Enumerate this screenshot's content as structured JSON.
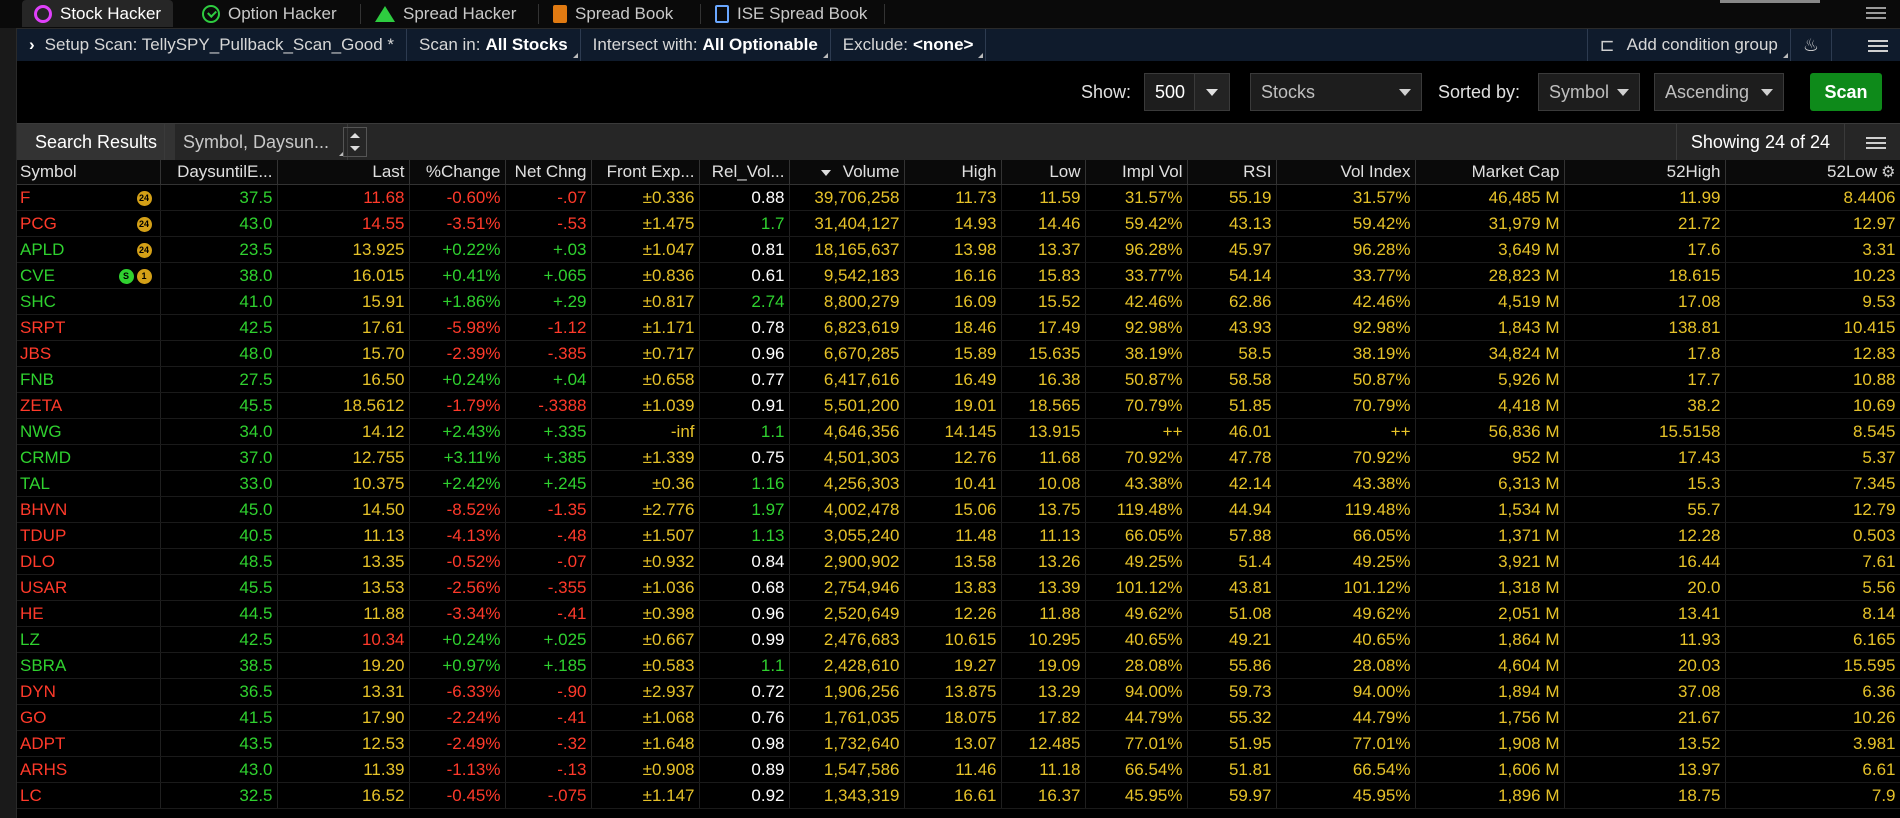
{
  "tabs": [
    {
      "label": "Stock Hacker",
      "icon": "stock-hacker-icon"
    },
    {
      "label": "Option Hacker",
      "icon": "option-hacker-icon"
    },
    {
      "label": "Spread Hacker",
      "icon": "spread-hacker-icon"
    },
    {
      "label": "Spread Book",
      "icon": "spread-book-icon"
    },
    {
      "label": "ISE Spread Book",
      "icon": "ise-spread-book-icon"
    }
  ],
  "setup": {
    "scan_label": "Setup Scan: TellySPY_Pullback_Scan_Good *",
    "scan_in_label": "Scan in:",
    "scan_in_value": "All Stocks",
    "intersect_label": "Intersect with:",
    "intersect_value": "All Optionable",
    "exclude_label": "Exclude:",
    "exclude_value": "<none>",
    "add_group": "Add condition group"
  },
  "controls": {
    "show_label": "Show:",
    "show_value": "500",
    "type_value": "Stocks",
    "sorted_label": "Sorted by:",
    "sort_field": "Symbol",
    "sort_order": "Ascending",
    "scan_button": "Scan"
  },
  "results": {
    "tab_label": "Search Results",
    "columns_label": "Symbol, Daysun...",
    "showing": "Showing 24 of 24"
  },
  "columns": [
    "Symbol",
    "DaysuntilE...",
    "Last",
    "%Change",
    "Net Chng",
    "Front Exp...",
    "Rel_Vol...",
    "Volume",
    "High",
    "Low",
    "Impl Vol",
    "RSI",
    "Vol Index",
    "Market Cap",
    "52High",
    "52Low"
  ],
  "rows": [
    {
      "sym": "F",
      "dir": "down",
      "rel": "w",
      "lastc": "r",
      "badges": [
        "24"
      ],
      "cells": [
        "37.5",
        "11.68",
        "-0.60%",
        "-.07",
        "±0.336",
        "0.88",
        "39,706,258",
        "11.73",
        "11.59",
        "31.57%",
        "55.19",
        "31.57%",
        "46,485 M",
        "11.99",
        "8.4406"
      ]
    },
    {
      "sym": "PCG",
      "dir": "down",
      "rel": "g",
      "lastc": "r",
      "badges": [
        "24"
      ],
      "cells": [
        "43.0",
        "14.55",
        "-3.51%",
        "-.53",
        "±1.475",
        "1.7",
        "31,404,127",
        "14.93",
        "14.46",
        "59.42%",
        "43.13",
        "59.42%",
        "31,979 M",
        "21.72",
        "12.97"
      ]
    },
    {
      "sym": "APLD",
      "dir": "up",
      "rel": "w",
      "lastc": "y",
      "badges": [
        "24"
      ],
      "cells": [
        "23.5",
        "13.925",
        "+0.22%",
        "+.03",
        "±1.047",
        "0.81",
        "18,165,637",
        "13.98",
        "13.37",
        "96.28%",
        "45.97",
        "96.28%",
        "3,649 M",
        "17.6",
        "3.31"
      ]
    },
    {
      "sym": "CVE",
      "dir": "up",
      "rel": "w",
      "lastc": "y",
      "badges": [
        "S",
        "1"
      ],
      "cells": [
        "38.0",
        "16.015",
        "+0.41%",
        "+.065",
        "±0.836",
        "0.61",
        "9,542,183",
        "16.16",
        "15.83",
        "33.77%",
        "54.14",
        "33.77%",
        "28,823 M",
        "18.615",
        "10.23"
      ]
    },
    {
      "sym": "SHC",
      "dir": "up",
      "rel": "g",
      "lastc": "y",
      "badges": [],
      "cells": [
        "41.0",
        "15.91",
        "+1.86%",
        "+.29",
        "±0.817",
        "2.74",
        "8,800,279",
        "16.09",
        "15.52",
        "42.46%",
        "62.86",
        "42.46%",
        "4,519 M",
        "17.08",
        "9.53"
      ]
    },
    {
      "sym": "SRPT",
      "dir": "down",
      "rel": "w",
      "lastc": "y",
      "badges": [],
      "cells": [
        "42.5",
        "17.61",
        "-5.98%",
        "-1.12",
        "±1.171",
        "0.78",
        "6,823,619",
        "18.46",
        "17.49",
        "92.98%",
        "43.93",
        "92.98%",
        "1,843 M",
        "138.81",
        "10.415"
      ]
    },
    {
      "sym": "JBS",
      "dir": "down",
      "rel": "w",
      "lastc": "y",
      "badges": [],
      "cells": [
        "48.0",
        "15.70",
        "-2.39%",
        "-.385",
        "±0.717",
        "0.96",
        "6,670,285",
        "15.89",
        "15.635",
        "38.19%",
        "58.5",
        "38.19%",
        "34,824 M",
        "17.8",
        "12.83"
      ]
    },
    {
      "sym": "FNB",
      "dir": "up",
      "rel": "w",
      "lastc": "y",
      "badges": [],
      "cells": [
        "27.5",
        "16.50",
        "+0.24%",
        "+.04",
        "±0.658",
        "0.77",
        "6,417,616",
        "16.49",
        "16.38",
        "50.87%",
        "58.58",
        "50.87%",
        "5,926 M",
        "17.7",
        "10.88"
      ]
    },
    {
      "sym": "ZETA",
      "dir": "down",
      "rel": "w",
      "lastc": "y",
      "badges": [],
      "cells": [
        "45.5",
        "18.5612",
        "-1.79%",
        "-.3388",
        "±1.039",
        "0.91",
        "5,501,200",
        "19.01",
        "18.565",
        "70.79%",
        "51.85",
        "70.79%",
        "4,418 M",
        "38.2",
        "10.69"
      ]
    },
    {
      "sym": "NWG",
      "dir": "up",
      "rel": "g",
      "lastc": "y",
      "badges": [],
      "cells": [
        "34.0",
        "14.12",
        "+2.43%",
        "+.335",
        "-inf",
        "1.1",
        "4,646,356",
        "14.145",
        "13.915",
        "++",
        "46.01",
        "++",
        "56,836 M",
        "15.5158",
        "8.545"
      ]
    },
    {
      "sym": "CRMD",
      "dir": "up",
      "rel": "w",
      "lastc": "y",
      "badges": [],
      "cells": [
        "37.0",
        "12.755",
        "+3.11%",
        "+.385",
        "±1.339",
        "0.75",
        "4,501,303",
        "12.76",
        "11.68",
        "70.92%",
        "47.78",
        "70.92%",
        "952 M",
        "17.43",
        "5.37"
      ]
    },
    {
      "sym": "TAL",
      "dir": "up",
      "rel": "g",
      "lastc": "y",
      "badges": [],
      "cells": [
        "33.0",
        "10.375",
        "+2.42%",
        "+.245",
        "±0.36",
        "1.16",
        "4,256,303",
        "10.41",
        "10.08",
        "43.38%",
        "42.14",
        "43.38%",
        "6,313 M",
        "15.3",
        "7.345"
      ]
    },
    {
      "sym": "BHVN",
      "dir": "down",
      "rel": "g",
      "lastc": "y",
      "badges": [],
      "cells": [
        "45.0",
        "14.50",
        "-8.52%",
        "-1.35",
        "±2.776",
        "1.97",
        "4,002,478",
        "15.06",
        "13.75",
        "119.48%",
        "44.94",
        "119.48%",
        "1,534 M",
        "55.7",
        "12.79"
      ]
    },
    {
      "sym": "TDUP",
      "dir": "down",
      "rel": "g",
      "lastc": "y",
      "badges": [],
      "cells": [
        "40.5",
        "11.13",
        "-4.13%",
        "-.48",
        "±1.507",
        "1.13",
        "3,055,240",
        "11.48",
        "11.13",
        "66.05%",
        "57.88",
        "66.05%",
        "1,371 M",
        "12.28",
        "0.503"
      ]
    },
    {
      "sym": "DLO",
      "dir": "down",
      "rel": "w",
      "lastc": "y",
      "badges": [],
      "cells": [
        "48.5",
        "13.35",
        "-0.52%",
        "-.07",
        "±0.932",
        "0.84",
        "2,900,902",
        "13.58",
        "13.26",
        "49.25%",
        "51.4",
        "49.25%",
        "3,921 M",
        "16.44",
        "7.61"
      ]
    },
    {
      "sym": "USAR",
      "dir": "down",
      "rel": "w",
      "lastc": "y",
      "badges": [],
      "cells": [
        "45.5",
        "13.53",
        "-2.56%",
        "-.355",
        "±1.036",
        "0.68",
        "2,754,946",
        "13.83",
        "13.39",
        "101.12%",
        "43.81",
        "101.12%",
        "1,318 M",
        "20.0",
        "5.56"
      ]
    },
    {
      "sym": "HE",
      "dir": "down",
      "rel": "w",
      "lastc": "y",
      "badges": [],
      "cells": [
        "44.5",
        "11.88",
        "-3.34%",
        "-.41",
        "±0.398",
        "0.96",
        "2,520,649",
        "12.26",
        "11.88",
        "49.62%",
        "51.08",
        "49.62%",
        "2,051 M",
        "13.41",
        "8.14"
      ]
    },
    {
      "sym": "LZ",
      "dir": "up",
      "rel": "w",
      "lastc": "r",
      "badges": [],
      "cells": [
        "42.5",
        "10.34",
        "+0.24%",
        "+.025",
        "±0.667",
        "0.99",
        "2,476,683",
        "10.615",
        "10.295",
        "40.65%",
        "49.21",
        "40.65%",
        "1,864 M",
        "11.93",
        "6.165"
      ]
    },
    {
      "sym": "SBRA",
      "dir": "up",
      "rel": "g",
      "lastc": "y",
      "badges": [],
      "cells": [
        "38.5",
        "19.20",
        "+0.97%",
        "+.185",
        "±0.583",
        "1.1",
        "2,428,610",
        "19.27",
        "19.09",
        "28.08%",
        "55.86",
        "28.08%",
        "4,604 M",
        "20.03",
        "15.595"
      ]
    },
    {
      "sym": "DYN",
      "dir": "down",
      "rel": "w",
      "lastc": "y",
      "badges": [],
      "cells": [
        "36.5",
        "13.31",
        "-6.33%",
        "-.90",
        "±2.937",
        "0.72",
        "1,906,256",
        "13.875",
        "13.29",
        "94.00%",
        "59.73",
        "94.00%",
        "1,894 M",
        "37.08",
        "6.36"
      ]
    },
    {
      "sym": "GO",
      "dir": "down",
      "rel": "w",
      "lastc": "y",
      "badges": [],
      "cells": [
        "41.5",
        "17.90",
        "-2.24%",
        "-.41",
        "±1.068",
        "0.76",
        "1,761,035",
        "18.075",
        "17.82",
        "44.79%",
        "55.32",
        "44.79%",
        "1,756 M",
        "21.67",
        "10.26"
      ]
    },
    {
      "sym": "ADPT",
      "dir": "down",
      "rel": "w",
      "lastc": "y",
      "badges": [],
      "cells": [
        "43.5",
        "12.53",
        "-2.49%",
        "-.32",
        "±1.648",
        "0.98",
        "1,732,640",
        "13.07",
        "12.485",
        "77.01%",
        "51.95",
        "77.01%",
        "1,908 M",
        "13.52",
        "3.981"
      ]
    },
    {
      "sym": "ARHS",
      "dir": "down",
      "rel": "w",
      "lastc": "y",
      "badges": [],
      "cells": [
        "43.0",
        "11.39",
        "-1.13%",
        "-.13",
        "±0.908",
        "0.89",
        "1,547,586",
        "11.46",
        "11.18",
        "66.54%",
        "51.81",
        "66.54%",
        "1,606 M",
        "13.97",
        "6.61"
      ]
    },
    {
      "sym": "LC",
      "dir": "down",
      "rel": "w",
      "lastc": "y",
      "badges": [],
      "cells": [
        "32.5",
        "16.52",
        "-0.45%",
        "-.075",
        "±1.147",
        "0.92",
        "1,343,319",
        "16.61",
        "16.37",
        "45.95%",
        "59.97",
        "45.95%",
        "1,896 M",
        "18.75",
        "7.9"
      ]
    }
  ]
}
